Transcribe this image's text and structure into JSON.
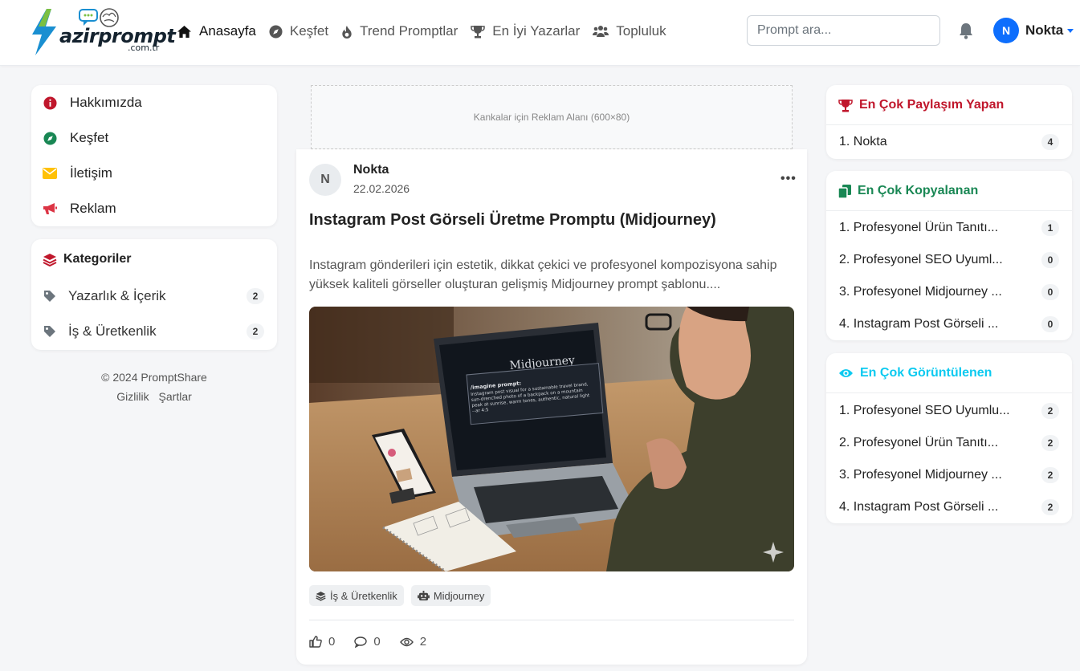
{
  "brand": {
    "logo_text": "azirprompt",
    "logo_sub": ".com.tr"
  },
  "nav": [
    {
      "label": "Anasayfa",
      "icon": "home-icon",
      "active": true
    },
    {
      "label": "Keşfet",
      "icon": "compass-icon"
    },
    {
      "label": "Trend Promptlar",
      "icon": "fire-icon"
    },
    {
      "label": "En İyi Yazarlar",
      "icon": "trophy-icon"
    },
    {
      "label": "Topluluk",
      "icon": "users-icon"
    }
  ],
  "search": {
    "placeholder": "Prompt ara..."
  },
  "user": {
    "initial": "N",
    "name": "Nokta"
  },
  "sidebar_menu": [
    {
      "label": "Hakkımızda",
      "icon": "info-circle-icon",
      "color": "#dc3545"
    },
    {
      "label": "Keşfet",
      "icon": "compass-icon",
      "color": "#198754"
    },
    {
      "label": "İletişim",
      "icon": "envelope-icon",
      "color": "#ffc107"
    },
    {
      "label": "Reklam",
      "icon": "megaphone-icon",
      "color": "#dc3545"
    }
  ],
  "categories": {
    "title": "Kategoriler",
    "items": [
      {
        "label": "Yazarlık & İçerik",
        "count": "2"
      },
      {
        "label": "İş & Üretkenlik",
        "count": "2"
      }
    ]
  },
  "footer": {
    "copyright": "© 2024 PromptShare",
    "privacy": "Gizlilik",
    "terms": "Şartlar"
  },
  "ad": {
    "text": "Kankalar için Reklam Alanı (600×80)"
  },
  "post": {
    "author_initial": "N",
    "author": "Nokta",
    "date": "22.02.2026",
    "more": "•••",
    "title": "Instagram Post Görseli Üretme Promptu (Midjourney)",
    "description": "Instagram gönderileri için estetik, dikkat çekici ve profesyonel kompozisyona sahip yüksek kaliteli görseller oluşturan gelişmiş Midjourney prompt şablonu....",
    "image": {
      "screen_logo": "Midjourney",
      "screen_text_bold": "/imagine prompt:",
      "screen_text": "Instagram post visual for a sustainable travel brand, sun-drenched photo of a backpack on a mountain peak at sunrise, warm tones, authentic, natural light --ar 4:5"
    },
    "tags": [
      {
        "label": "İş & Üretkenlik",
        "icon": "layers-icon"
      },
      {
        "label": "Midjourney",
        "icon": "robot-icon"
      }
    ],
    "likes": "0",
    "comments": "0",
    "views": "2"
  },
  "top_sharers": {
    "title": "En Çok Paylaşım Yapan",
    "color": "#c0172c",
    "items": [
      {
        "label": "1. Nokta",
        "count": "4"
      }
    ]
  },
  "most_copied": {
    "title": "En Çok Kopyalanan",
    "color": "#198754",
    "items": [
      {
        "label": "1. Profesyonel Ürün Tanıtı...",
        "count": "1"
      },
      {
        "label": "2. Profesyonel SEO Uyuml...",
        "count": "0"
      },
      {
        "label": "3. Profesyonel Midjourney ...",
        "count": "0"
      },
      {
        "label": "4. Instagram Post Görseli ...",
        "count": "0"
      }
    ]
  },
  "most_viewed": {
    "title": "En Çok Görüntülenen",
    "color": "#0dcaf0",
    "items": [
      {
        "label": "1. Profesyonel SEO Uyumlu...",
        "count": "2"
      },
      {
        "label": "2. Profesyonel Ürün Tanıtı...",
        "count": "2"
      },
      {
        "label": "3. Profesyonel Midjourney ...",
        "count": "2"
      },
      {
        "label": "4. Instagram Post Görseli ...",
        "count": "2"
      }
    ]
  }
}
